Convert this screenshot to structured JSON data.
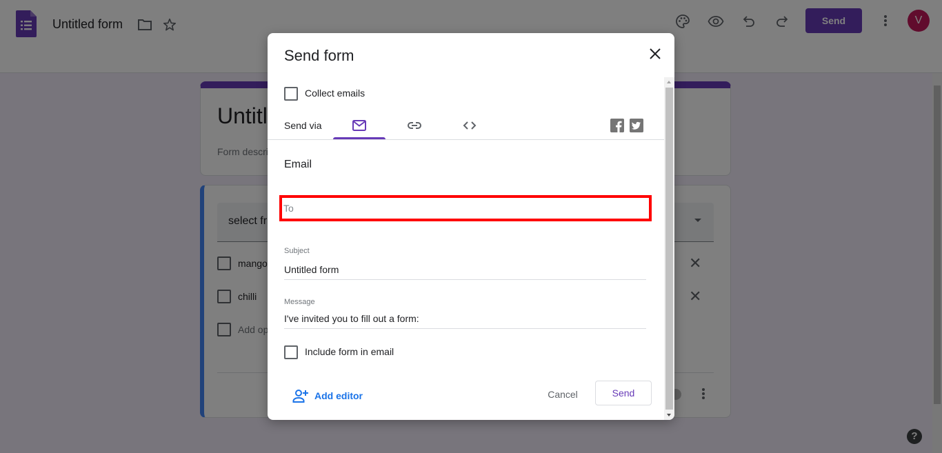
{
  "app": {
    "doc_title": "Untitled form",
    "send_label": "Send",
    "avatar_initial": "V",
    "accent_color": "#673ab7",
    "icons": [
      "forms-logo-icon",
      "folder-icon",
      "star-icon",
      "palette-icon",
      "eye-icon",
      "undo-icon",
      "redo-icon",
      "more-vert-icon",
      "help-icon"
    ]
  },
  "form": {
    "title": "Untitled form",
    "description_placeholder": "Form description",
    "question": {
      "select_text": "select fruit",
      "options": [
        {
          "label": "mango"
        },
        {
          "label": "chilli"
        }
      ],
      "add_option": "Add option"
    }
  },
  "dialog": {
    "title": "Send form",
    "collect_emails": {
      "label": "Collect emails",
      "checked": false
    },
    "send_via_label": "Send via",
    "tabs": [
      {
        "name": "email",
        "icon": "mail-icon",
        "active": true
      },
      {
        "name": "link",
        "icon": "link-icon",
        "active": false
      },
      {
        "name": "embed",
        "icon": "code-icon",
        "active": false
      }
    ],
    "social": [
      {
        "name": "facebook",
        "icon": "facebook-icon",
        "glyph": "f"
      },
      {
        "name": "twitter",
        "icon": "twitter-icon",
        "glyph": "t"
      }
    ],
    "section_title": "Email",
    "to": {
      "value": "",
      "placeholder": "To"
    },
    "subject": {
      "label": "Subject",
      "value": "Untitled form"
    },
    "message": {
      "label": "Message",
      "value": "I've invited you to fill out a form:"
    },
    "include_form": {
      "label": "Include form in email",
      "checked": false
    },
    "add_editor_label": "Add editor",
    "cancel_label": "Cancel",
    "send_label": "Send"
  }
}
